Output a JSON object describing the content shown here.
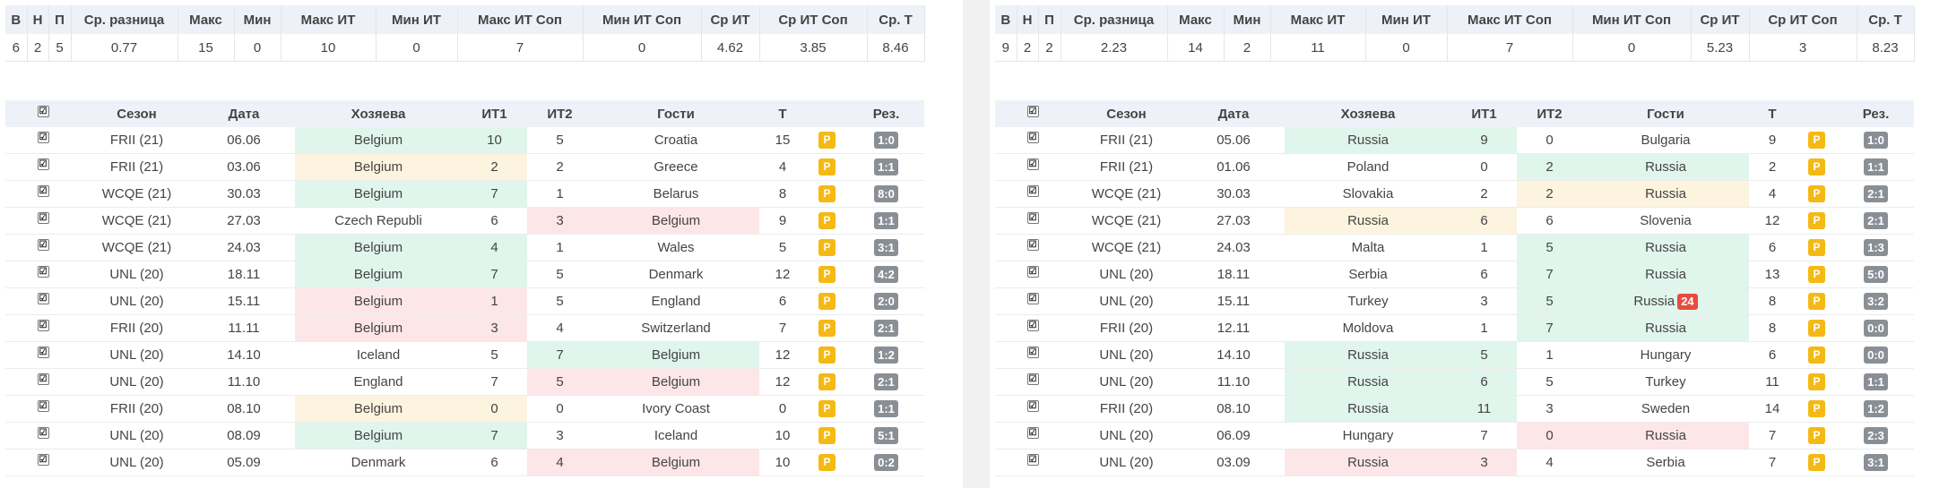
{
  "stats_headers": [
    "В",
    "Н",
    "П",
    "Ср. разница",
    "Макс",
    "Мин",
    "Макс ИТ",
    "Мин ИТ",
    "Макс ИТ Соп",
    "Мин ИТ Соп",
    "Ср ИТ",
    "Ср ИТ Соп",
    "Ср. Т"
  ],
  "games_headers": [
    "☑",
    "Сезон",
    "Дата",
    "Хозяева",
    "ИТ1",
    "ИТ2",
    "Гости",
    "Т",
    "",
    "Рез."
  ],
  "p_badge": "P",
  "colors": {
    "green": "#e0f5ec",
    "yellow": "#fdf4df",
    "red": "#fde6e8",
    "p_badge": "#f5b914",
    "score_badge": "#8a8f96",
    "alert_badge": "#e74c3c"
  },
  "left": {
    "stats": [
      "6",
      "2",
      "5",
      "0.77",
      "15",
      "0",
      "10",
      "0",
      "7",
      "0",
      "4.62",
      "3.85",
      "8.46"
    ],
    "games": [
      {
        "season": "FRII (21)",
        "date": "06.06",
        "home": "Belgium",
        "it1": "10",
        "it2": "5",
        "away": "Croatia",
        "total": "15",
        "score": "1:0",
        "hl": "home",
        "color": "g"
      },
      {
        "season": "FRII (21)",
        "date": "03.06",
        "home": "Belgium",
        "it1": "2",
        "it2": "2",
        "away": "Greece",
        "total": "4",
        "score": "1:1",
        "hl": "home",
        "color": "y"
      },
      {
        "season": "WCQE (21)",
        "date": "30.03",
        "home": "Belgium",
        "it1": "7",
        "it2": "1",
        "away": "Belarus",
        "total": "8",
        "score": "8:0",
        "hl": "home",
        "color": "g"
      },
      {
        "season": "WCQE (21)",
        "date": "27.03",
        "home": "Czech Republi",
        "it1": "6",
        "it2": "3",
        "away": "Belgium",
        "total": "9",
        "score": "1:1",
        "hl": "away",
        "color": "r"
      },
      {
        "season": "WCQE (21)",
        "date": "24.03",
        "home": "Belgium",
        "it1": "4",
        "it2": "1",
        "away": "Wales",
        "total": "5",
        "score": "3:1",
        "hl": "home",
        "color": "g"
      },
      {
        "season": "UNL (20)",
        "date": "18.11",
        "home": "Belgium",
        "it1": "7",
        "it2": "5",
        "away": "Denmark",
        "total": "12",
        "score": "4:2",
        "hl": "home",
        "color": "g"
      },
      {
        "season": "UNL (20)",
        "date": "15.11",
        "home": "Belgium",
        "it1": "1",
        "it2": "5",
        "away": "England",
        "total": "6",
        "score": "2:0",
        "hl": "home",
        "color": "r"
      },
      {
        "season": "FRII (20)",
        "date": "11.11",
        "home": "Belgium",
        "it1": "3",
        "it2": "4",
        "away": "Switzerland",
        "total": "7",
        "score": "2:1",
        "hl": "home",
        "color": "r"
      },
      {
        "season": "UNL (20)",
        "date": "14.10",
        "home": "Iceland",
        "it1": "5",
        "it2": "7",
        "away": "Belgium",
        "total": "12",
        "score": "1:2",
        "hl": "away",
        "color": "g"
      },
      {
        "season": "UNL (20)",
        "date": "11.10",
        "home": "England",
        "it1": "7",
        "it2": "5",
        "away": "Belgium",
        "total": "12",
        "score": "2:1",
        "hl": "away",
        "color": "r"
      },
      {
        "season": "FRII (20)",
        "date": "08.10",
        "home": "Belgium",
        "it1": "0",
        "it2": "0",
        "away": "Ivory Coast",
        "total": "0",
        "score": "1:1",
        "hl": "home",
        "color": "y"
      },
      {
        "season": "UNL (20)",
        "date": "08.09",
        "home": "Belgium",
        "it1": "7",
        "it2": "3",
        "away": "Iceland",
        "total": "10",
        "score": "5:1",
        "hl": "home",
        "color": "g"
      },
      {
        "season": "UNL (20)",
        "date": "05.09",
        "home": "Denmark",
        "it1": "6",
        "it2": "4",
        "away": "Belgium",
        "total": "10",
        "score": "0:2",
        "hl": "away",
        "color": "r"
      }
    ]
  },
  "right": {
    "stats": [
      "9",
      "2",
      "2",
      "2.23",
      "14",
      "2",
      "11",
      "0",
      "7",
      "0",
      "5.23",
      "3",
      "8.23"
    ],
    "games": [
      {
        "season": "FRII (21)",
        "date": "05.06",
        "home": "Russia",
        "it1": "9",
        "it2": "0",
        "away": "Bulgaria",
        "total": "9",
        "score": "1:0",
        "hl": "home",
        "color": "g"
      },
      {
        "season": "FRII (21)",
        "date": "01.06",
        "home": "Poland",
        "it1": "0",
        "it2": "2",
        "away": "Russia",
        "total": "2",
        "score": "1:1",
        "hl": "away",
        "color": "g"
      },
      {
        "season": "WCQE (21)",
        "date": "30.03",
        "home": "Slovakia",
        "it1": "2",
        "it2": "2",
        "away": "Russia",
        "total": "4",
        "score": "2:1",
        "hl": "away",
        "color": "y"
      },
      {
        "season": "WCQE (21)",
        "date": "27.03",
        "home": "Russia",
        "it1": "6",
        "it2": "6",
        "away": "Slovenia",
        "total": "12",
        "score": "2:1",
        "hl": "home",
        "color": "y"
      },
      {
        "season": "WCQE (21)",
        "date": "24.03",
        "home": "Malta",
        "it1": "1",
        "it2": "5",
        "away": "Russia",
        "total": "6",
        "score": "1:3",
        "hl": "away",
        "color": "g"
      },
      {
        "season": "UNL (20)",
        "date": "18.11",
        "home": "Serbia",
        "it1": "6",
        "it2": "7",
        "away": "Russia",
        "total": "13",
        "score": "5:0",
        "hl": "away",
        "color": "g"
      },
      {
        "season": "UNL (20)",
        "date": "15.11",
        "home": "Turkey",
        "it1": "3",
        "it2": "5",
        "away": "Russia",
        "badge": "24",
        "total": "8",
        "score": "3:2",
        "hl": "away",
        "color": "g"
      },
      {
        "season": "FRII (20)",
        "date": "12.11",
        "home": "Moldova",
        "it1": "1",
        "it2": "7",
        "away": "Russia",
        "total": "8",
        "score": "0:0",
        "hl": "away",
        "color": "g"
      },
      {
        "season": "UNL (20)",
        "date": "14.10",
        "home": "Russia",
        "it1": "5",
        "it2": "1",
        "away": "Hungary",
        "total": "6",
        "score": "0:0",
        "hl": "home",
        "color": "g"
      },
      {
        "season": "UNL (20)",
        "date": "11.10",
        "home": "Russia",
        "it1": "6",
        "it2": "5",
        "away": "Turkey",
        "total": "11",
        "score": "1:1",
        "hl": "home",
        "color": "g"
      },
      {
        "season": "FRII (20)",
        "date": "08.10",
        "home": "Russia",
        "it1": "11",
        "it2": "3",
        "away": "Sweden",
        "total": "14",
        "score": "1:2",
        "hl": "home",
        "color": "g"
      },
      {
        "season": "UNL (20)",
        "date": "06.09",
        "home": "Hungary",
        "it1": "7",
        "it2": "0",
        "away": "Russia",
        "total": "7",
        "score": "2:3",
        "hl": "away",
        "color": "r"
      },
      {
        "season": "UNL (20)",
        "date": "03.09",
        "home": "Russia",
        "it1": "3",
        "it2": "4",
        "away": "Serbia",
        "total": "7",
        "score": "3:1",
        "hl": "home",
        "color": "r"
      }
    ]
  }
}
